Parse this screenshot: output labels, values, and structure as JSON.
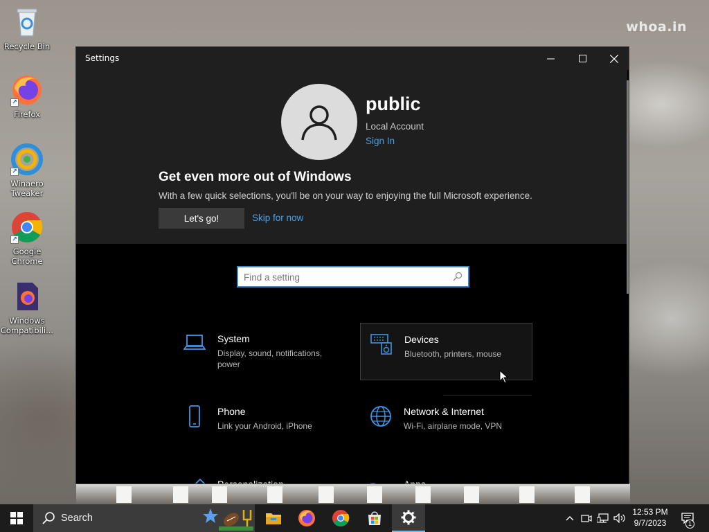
{
  "desktop": {
    "watermark": "whoa.in",
    "icons": [
      {
        "label": "Recycle Bin"
      },
      {
        "label": "Firefox"
      },
      {
        "label": "Winaero Tweaker"
      },
      {
        "label": "Google Chrome"
      },
      {
        "label": "Windows Compatibili..."
      }
    ]
  },
  "window": {
    "title": "Settings",
    "controls": {
      "minimize": "minimize-icon",
      "maximize": "maximize-icon",
      "close": "close-icon"
    }
  },
  "account": {
    "name": "public",
    "type": "Local Account",
    "sign_in": "Sign In"
  },
  "promo": {
    "title": "Get even more out of Windows",
    "text": "With a few quick selections, you'll be on your way to enjoying the full Microsoft experience.",
    "primary_button": "Let's go!",
    "secondary_link": "Skip for now"
  },
  "search": {
    "placeholder": "Find a setting"
  },
  "categories": [
    {
      "name": "System",
      "desc": "Display, sound, notifications, power",
      "icon": "laptop-icon"
    },
    {
      "name": "Devices",
      "desc": "Bluetooth, printers, mouse",
      "icon": "devices-icon"
    },
    {
      "name": "Phone",
      "desc": "Link your Android, iPhone",
      "icon": "phone-icon"
    },
    {
      "name": "Network & Internet",
      "desc": "Wi-Fi, airplane mode, VPN",
      "icon": "globe-icon"
    },
    {
      "name": "Personalization",
      "desc": "",
      "icon": "brush-icon"
    },
    {
      "name": "Apps",
      "desc": "",
      "icon": "apps-list-icon"
    }
  ],
  "taskbar": {
    "search_label": "Search",
    "apps": [
      "file-explorer-icon",
      "firefox-icon",
      "chrome-icon",
      "store-icon",
      "settings-icon"
    ],
    "time": "12:53 PM",
    "date": "9/7/2023",
    "notification_count": "1"
  },
  "colors": {
    "accent": "#4aa0e6",
    "window_bg": "#000000",
    "panel_bg": "#1f1f1f",
    "search_border": "#3f84c8"
  }
}
